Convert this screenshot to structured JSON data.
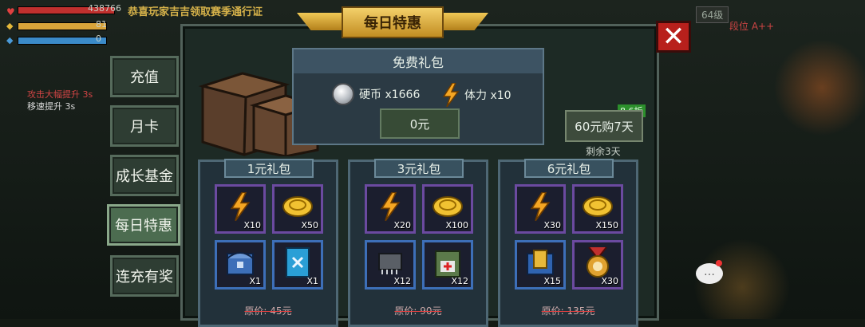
{
  "hud": {
    "hp": "438766",
    "stat2": "81",
    "stat3": "0",
    "buff1": "攻击大幅提升 3s",
    "buff2": "移速提升 3s",
    "notice": "恭喜玩家吉吉领取赛季通行证",
    "level": "64级",
    "rank": "段位 A++"
  },
  "title": "每日特惠",
  "sidebar": [
    {
      "label": "充值"
    },
    {
      "label": "月卡"
    },
    {
      "label": "成长基金"
    },
    {
      "label": "每日特惠"
    },
    {
      "label": "连充有奖"
    }
  ],
  "free_pack": {
    "title": "免费礼包",
    "item1": "硬币 x1666",
    "item2": "体力 x10",
    "button": "0元"
  },
  "weekly": {
    "discount": "8.6折",
    "button": "60元购7天",
    "remaining": "剩余3天"
  },
  "packs": [
    {
      "title": "1元礼包",
      "original_price": "原价: 45元",
      "items": [
        {
          "icon": "energy-bolt-icon",
          "count": "X10"
        },
        {
          "icon": "gold-coin-icon",
          "count": "X50"
        },
        {
          "icon": "blue-chest-icon",
          "count": "X1"
        },
        {
          "icon": "tool-blueprint-icon",
          "count": "X1"
        }
      ]
    },
    {
      "title": "3元礼包",
      "original_price": "原价: 90元",
      "items": [
        {
          "icon": "energy-bolt-icon",
          "count": "X20"
        },
        {
          "icon": "gold-coin-icon",
          "count": "X100"
        },
        {
          "icon": "circuit-chip-icon",
          "count": "X12"
        },
        {
          "icon": "medkit-backpack-icon",
          "count": "X12"
        }
      ]
    },
    {
      "title": "6元礼包",
      "original_price": "原价: 135元",
      "items": [
        {
          "icon": "energy-bolt-icon",
          "count": "X30"
        },
        {
          "icon": "gold-coin-icon",
          "count": "X150"
        },
        {
          "icon": "gold-blue-chest-icon",
          "count": "X15"
        },
        {
          "icon": "medal-badge-icon",
          "count": "X30"
        }
      ]
    }
  ],
  "colors": {
    "accent_gold": "#f0c855",
    "close_red": "#b8201c",
    "panel_bg": "#1d2a25"
  }
}
